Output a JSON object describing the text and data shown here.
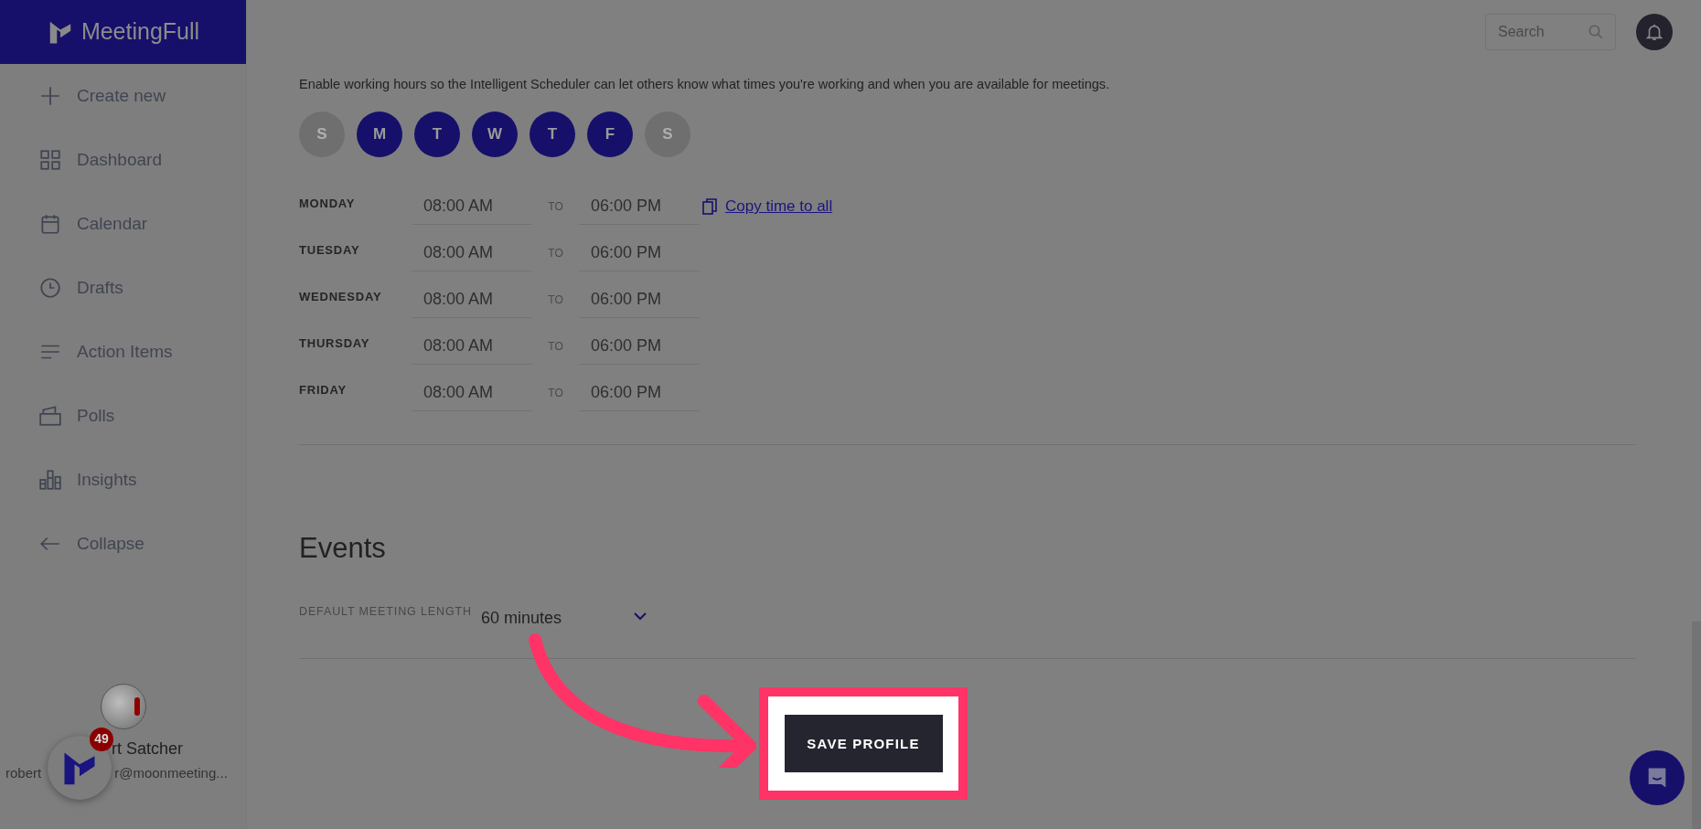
{
  "brand": {
    "name": "MeetingFull"
  },
  "sidebar": {
    "items": [
      {
        "label": "Create new",
        "kind": "plus"
      },
      {
        "label": "Dashboard",
        "kind": "grid"
      },
      {
        "label": "Calendar",
        "kind": "calendar"
      },
      {
        "label": "Drafts",
        "kind": "clock"
      },
      {
        "label": "Action Items",
        "kind": "lines"
      },
      {
        "label": "Polls",
        "kind": "poll"
      },
      {
        "label": "Insights",
        "kind": "bars"
      },
      {
        "label": "Collapse",
        "kind": "arrow"
      }
    ]
  },
  "user": {
    "name": "rt Satcher",
    "email_start": "robert",
    "email_end": "r@moonmeeting..."
  },
  "notification_badge": "49",
  "search": {
    "placeholder": "Search"
  },
  "working_hours": {
    "description": "Enable working hours so the Intelligent Scheduler can let others know what times you're working and when you are available for meetings.",
    "days": [
      {
        "letter": "S",
        "selected": false
      },
      {
        "letter": "M",
        "selected": true
      },
      {
        "letter": "T",
        "selected": true
      },
      {
        "letter": "W",
        "selected": true
      },
      {
        "letter": "T",
        "selected": true
      },
      {
        "letter": "F",
        "selected": true
      },
      {
        "letter": "S",
        "selected": false
      }
    ],
    "schedule": [
      {
        "day": "MONDAY",
        "start": "08:00 AM",
        "separator": "TO",
        "end": "06:00 PM"
      },
      {
        "day": "TUESDAY",
        "start": "08:00 AM",
        "separator": "TO",
        "end": "06:00 PM"
      },
      {
        "day": "WEDNESDAY",
        "start": "08:00 AM",
        "separator": "TO",
        "end": "06:00 PM"
      },
      {
        "day": "THURSDAY",
        "start": "08:00 AM",
        "separator": "TO",
        "end": "06:00 PM"
      },
      {
        "day": "FRIDAY",
        "start": "08:00 AM",
        "separator": "TO",
        "end": "06:00 PM"
      }
    ],
    "copy_link": "Copy time to all"
  },
  "events": {
    "title": "Events",
    "default_length": {
      "label": "DEFAULT MEETING LENGTH",
      "value": "60 minutes"
    }
  },
  "save_button": "SAVE PROFILE"
}
